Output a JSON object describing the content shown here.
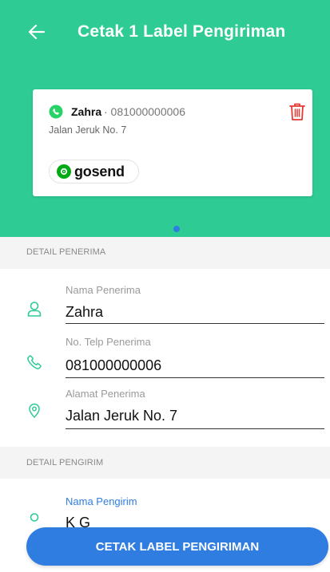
{
  "appbar": {
    "title": "Cetak 1 Label Pengiriman"
  },
  "label_card": {
    "name": "Zahra",
    "phone": "· 081000000006",
    "address": "Jalan Jeruk No. 7",
    "courier": "gosend"
  },
  "carousel": {
    "pages": 1,
    "active_page": 1
  },
  "receiver_section": {
    "title": "DETAIL PENERIMA",
    "name_label": "Nama Penerima",
    "name_value": "Zahra",
    "phone_label": "No. Telp Penerima",
    "phone_value": "081000000006",
    "address_label": "Alamat Penerima",
    "address_value": "Jalan Jeruk No. 7"
  },
  "sender_section": {
    "title": "DETAIL PENGIRIM",
    "name_label": "Nama Pengirim",
    "name_value": "K G"
  },
  "actions": {
    "print_label": "CETAK LABEL PENGIRIMAN"
  },
  "colors": {
    "header_green": "#2ecc94",
    "accent_blue": "#2f7de1",
    "icon_green": "#2ecc94",
    "delete_red": "#e53935",
    "whatsapp_green": "#25d366",
    "gojek_green": "#00aa13"
  },
  "icons": {
    "back": "arrow-left-icon",
    "whatsapp": "whatsapp-icon",
    "delete": "trash-icon",
    "person": "person-icon",
    "phone": "phone-icon",
    "location": "location-pin-icon"
  }
}
